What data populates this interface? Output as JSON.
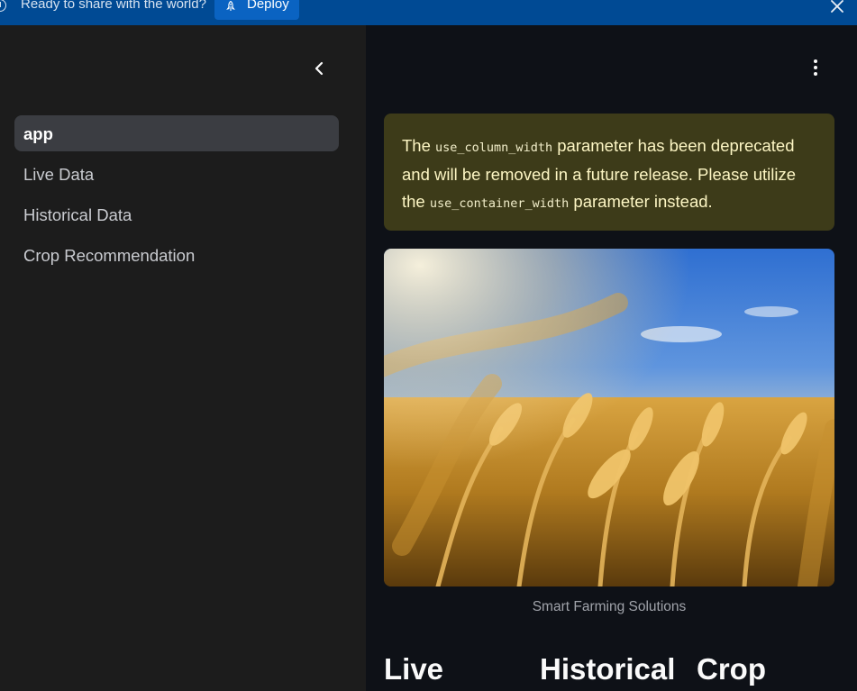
{
  "banner": {
    "message": "Ready to share with the world?",
    "deploy_label": "Deploy"
  },
  "sidebar": {
    "items": [
      {
        "label": "app",
        "active": true
      },
      {
        "label": "Live Data",
        "active": false
      },
      {
        "label": "Historical Data",
        "active": false
      },
      {
        "label": "Crop Recommendation",
        "active": false
      }
    ]
  },
  "main": {
    "warning": {
      "part1": "The ",
      "code1": "use_column_width",
      "part2": " parameter has been deprecated and will be removed in a future release. Please utilize the ",
      "code2": "use_container_width",
      "part3": " parameter instead."
    },
    "image_caption": "Smart Farming Solutions",
    "columns": [
      "Live",
      "Historical",
      "Crop"
    ]
  },
  "colors": {
    "banner_bg": "#004a94",
    "deploy_bg": "#0a63c2",
    "sidebar_bg": "#1c1c1c",
    "main_bg": "#0e1117",
    "warning_bg": "#3d3b19",
    "warning_text": "#fdf6c4"
  },
  "icons": [
    "info-icon",
    "rocket-icon",
    "close-icon",
    "chevron-left-icon",
    "kebab-menu-icon"
  ]
}
